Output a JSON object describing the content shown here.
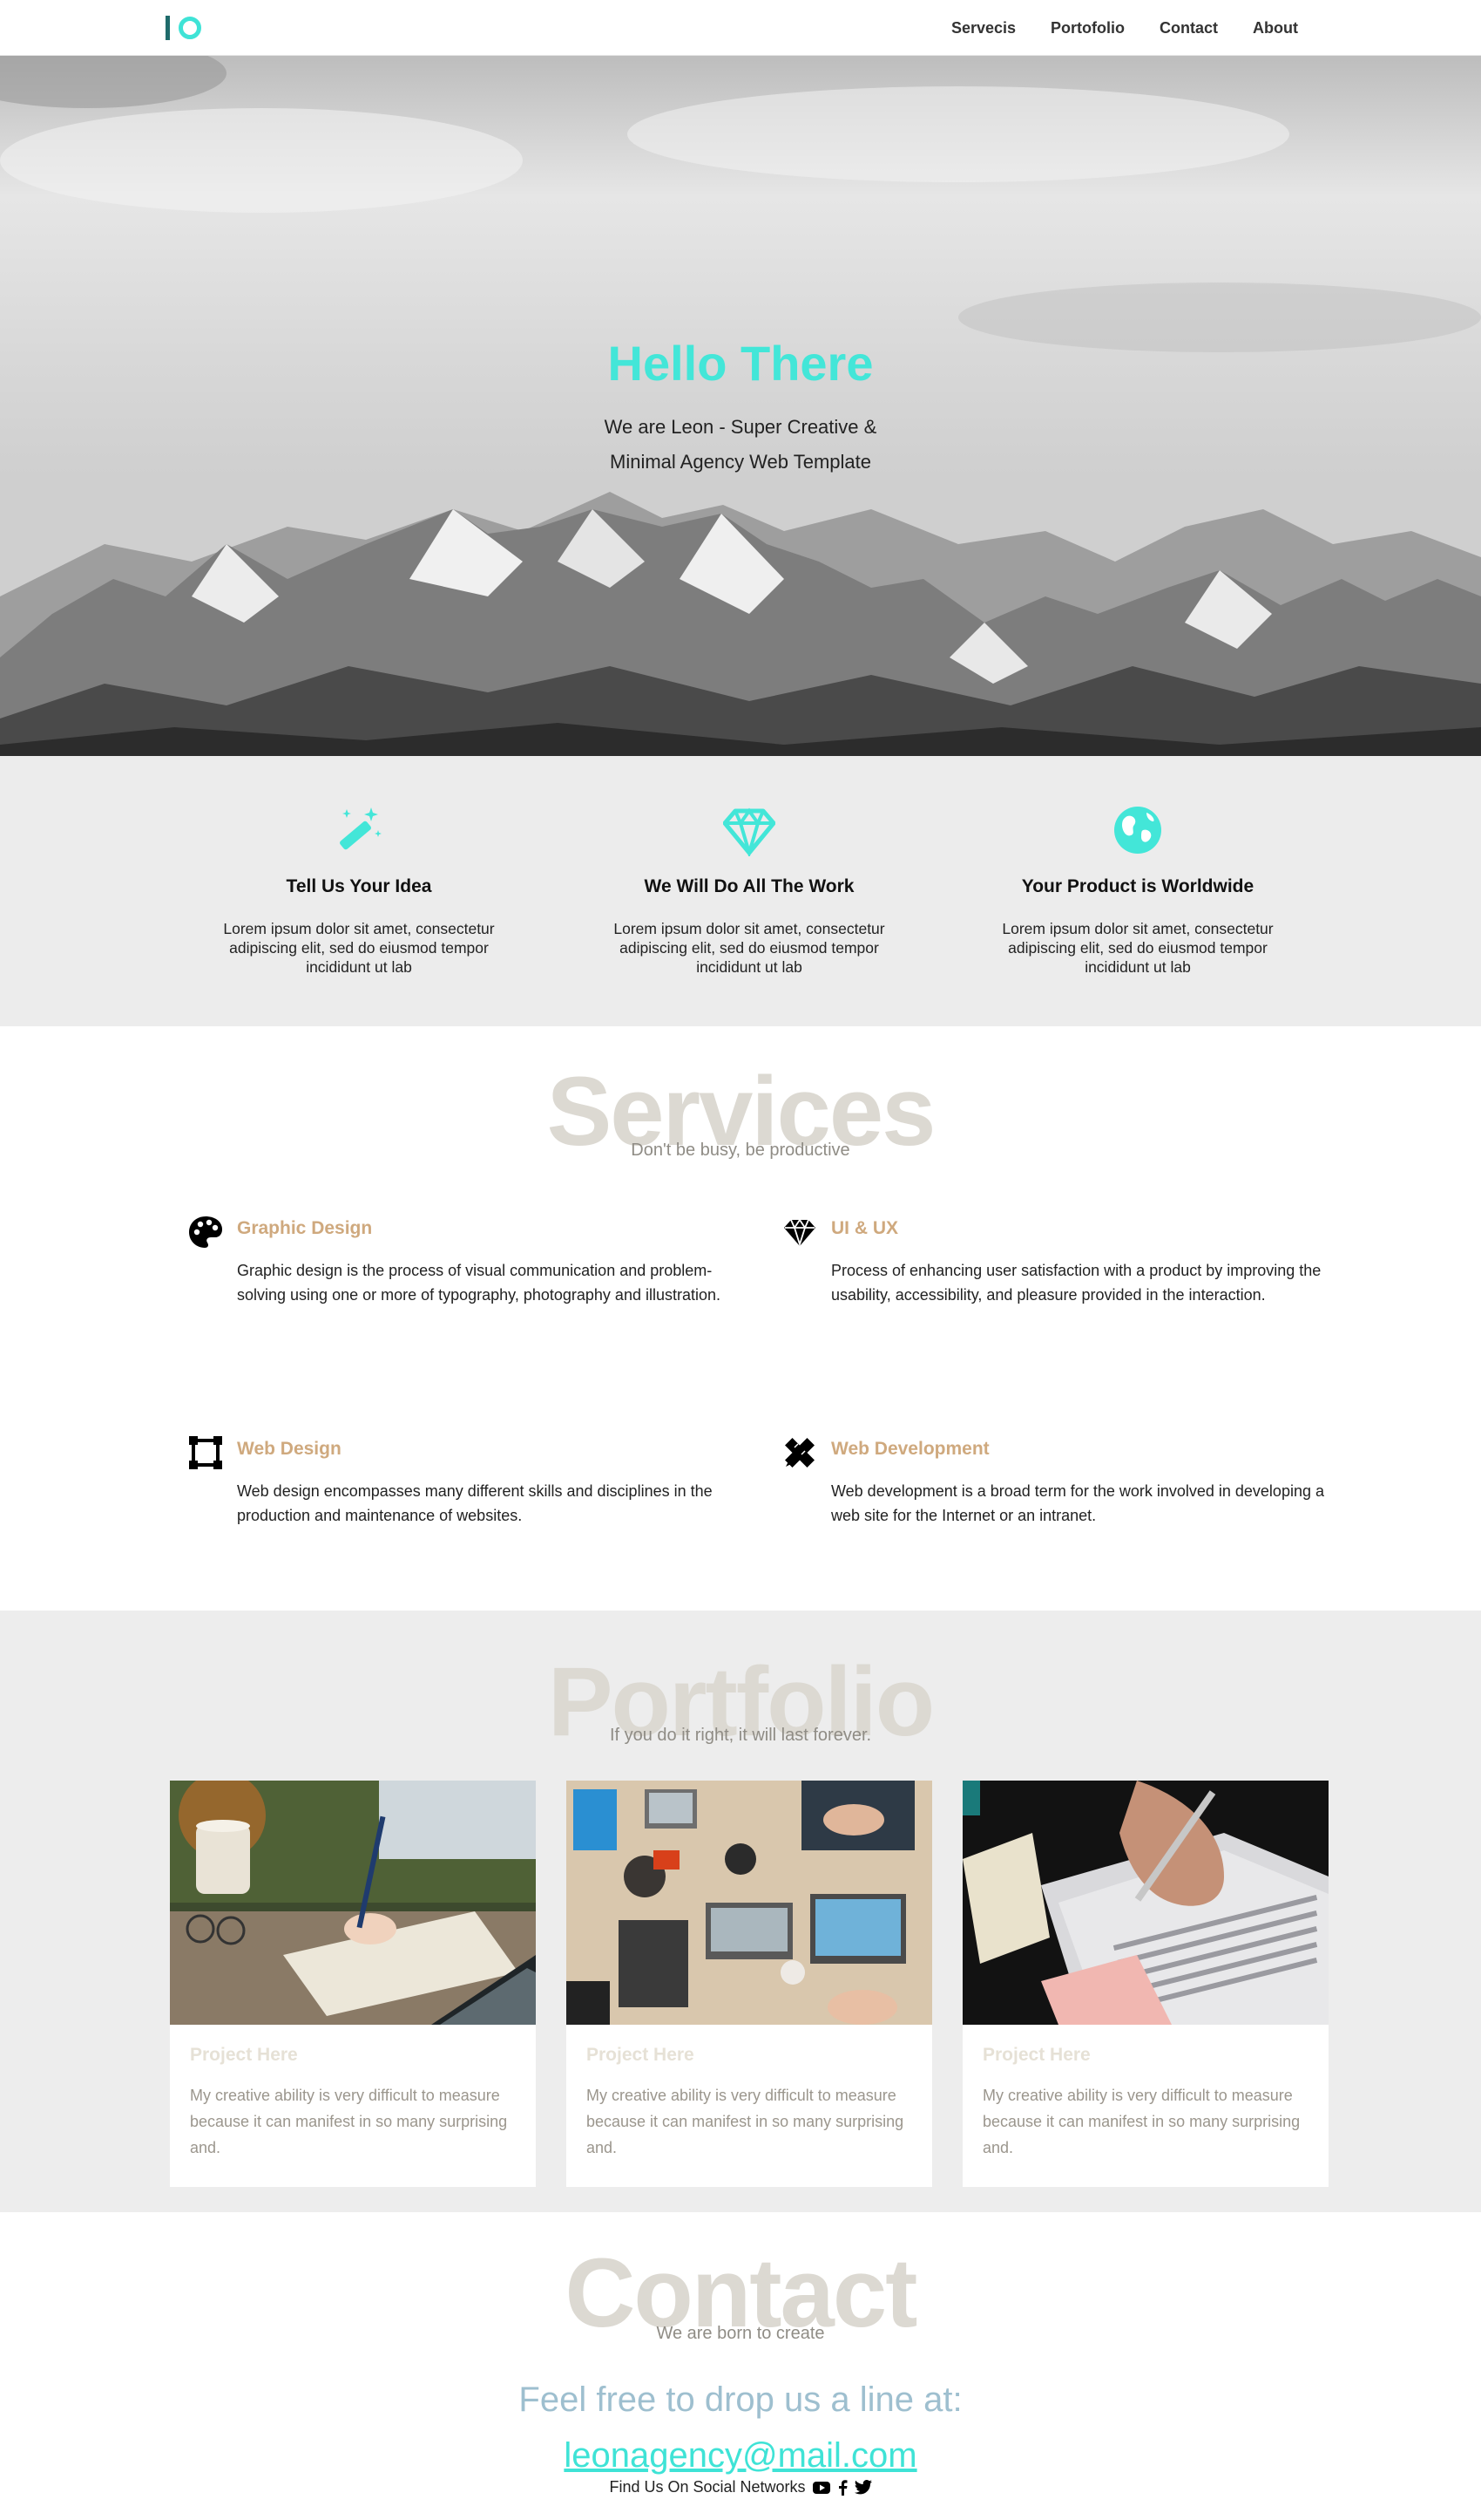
{
  "nav": {
    "items": [
      "Servecis",
      "Portofolio",
      "Contact",
      "About"
    ]
  },
  "hero": {
    "title": "Hello There",
    "subtitle_line1": "We are Leon - Super Creative &",
    "subtitle_line2": "Minimal Agency Web Template"
  },
  "features": [
    {
      "icon": "magic-wand-icon",
      "title": "Tell Us Your Idea",
      "text": "Lorem ipsum dolor sit amet, consectetur adipiscing elit, sed do eiusmod tempor incididunt ut lab"
    },
    {
      "icon": "diamond-icon",
      "title": "We Will Do All The Work",
      "text": "Lorem ipsum dolor sit amet, consectetur adipiscing elit, sed do eiusmod tempor incididunt ut lab"
    },
    {
      "icon": "globe-icon",
      "title": "Your Product is Worldwide",
      "text": "Lorem ipsum dolor sit amet, consectetur adipiscing elit, sed do eiusmod tempor incididunt ut lab"
    }
  ],
  "services": {
    "heading": "Services",
    "subheading": "Don't be busy, be productive",
    "items": [
      {
        "icon": "palette-icon",
        "title": "Graphic Design",
        "text": "Graphic design is the process of visual communication and problem-solving using one or more of typography, photography and illustration."
      },
      {
        "icon": "gem-icon",
        "title": "UI & UX",
        "text": "Process of enhancing user satisfaction with a product by improving the usability, accessibility, and pleasure provided in the interaction."
      },
      {
        "icon": "vector-square-icon",
        "title": "Web Design",
        "text": "Web design encompasses many different skills and disciplines in the production and maintenance of websites."
      },
      {
        "icon": "pencil-ruler-icon",
        "title": "Web Development",
        "text": "Web development is a broad term for the work involved in developing a web site for the Internet or an intranet."
      }
    ]
  },
  "portfolio": {
    "heading": "Portfolio",
    "subheading": "If you do it right, it will last forever.",
    "cards": [
      {
        "title": "Project Here",
        "text": "My creative ability is very difficult to measure because it can manifest in so many surprising and."
      },
      {
        "title": "Project Here",
        "text": "My creative ability is very difficult to measure because it can manifest in so many surprising and."
      },
      {
        "title": "Project Here",
        "text": "My creative ability is very difficult to measure because it can manifest in so many surprising and."
      }
    ]
  },
  "contact": {
    "heading": "Contact",
    "subheading": "We are born to create",
    "line": "Feel free to drop us a line at:",
    "email": "leonagency@mail.com",
    "social_label": "Find Us On Social Networks",
    "social_icons": [
      "youtube-icon",
      "facebook-icon",
      "twitter-icon"
    ]
  },
  "colors": {
    "accent": "#43e6d8",
    "service_title": "#cfa97e",
    "heading_watermark": "#dcd9d2"
  }
}
